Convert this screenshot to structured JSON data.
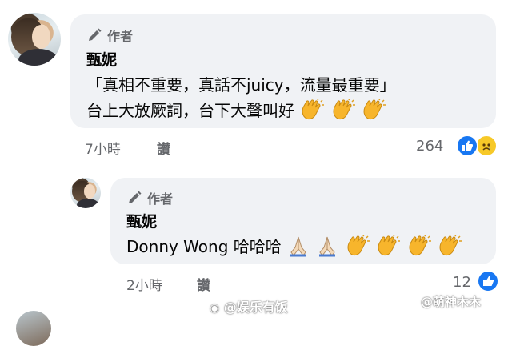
{
  "comment1": {
    "author_badge": "作者",
    "name": "甄妮",
    "lines": [
      "「真相不重要，真話不juicy，流量最重要」",
      "台上大放厥詞，台下大聲叫好"
    ],
    "emojis": [
      "clapping-hands",
      "clapping-hands",
      "clapping-hands"
    ],
    "time": "7小時",
    "like_label": "讚",
    "reaction_count": "264",
    "reactions": [
      "like",
      "sad"
    ]
  },
  "comment2": {
    "author_badge": "作者",
    "name": "甄妮",
    "text": "Donny Wong 哈哈哈",
    "emojis": [
      "folded-hands",
      "folded-hands",
      "clapping-hands",
      "clapping-hands",
      "clapping-hands",
      "clapping-hands"
    ],
    "time": "2小時",
    "like_label": "讚",
    "reaction_count": "12",
    "reactions": [
      "like"
    ]
  },
  "watermarks": [
    "@娱乐有饭",
    "@萌神木木"
  ],
  "colors": {
    "bubble": "#f0f2f5",
    "meta_text": "#65676b",
    "like_blue": "#1877f2",
    "sad_yellow": "#f7c928"
  }
}
